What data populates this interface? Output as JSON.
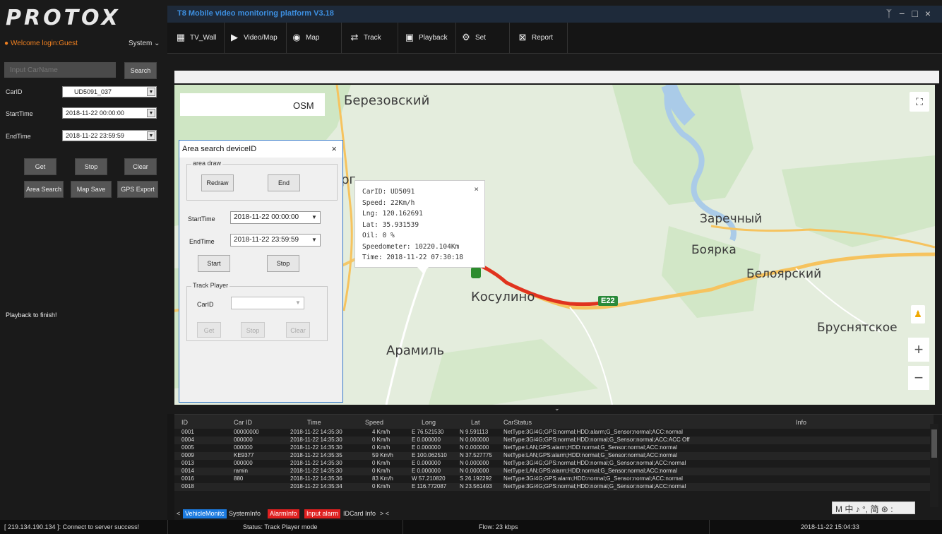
{
  "app": {
    "logo": "PROTOX",
    "title": "T8 Mobile video monitoring platform V3.18",
    "welcome": "Welcome login:Guest",
    "system_menu": "System"
  },
  "nav": [
    {
      "label": "TV_Wall",
      "icon": "grid-icon"
    },
    {
      "label": "Video/Map",
      "icon": "play-icon"
    },
    {
      "label": "Map",
      "icon": "map-pin-icon"
    },
    {
      "label": "Track",
      "icon": "track-icon"
    },
    {
      "label": "Playback",
      "icon": "camera-icon"
    },
    {
      "label": "Set",
      "icon": "gear-icon"
    },
    {
      "label": "Report",
      "icon": "report-icon"
    }
  ],
  "left": {
    "car_name_placeholder": "Input CarName",
    "search": "Search",
    "carid_label": "CarID",
    "carid_value": "UD5091_037",
    "starttime_label": "StartTime",
    "starttime_value": "2018-11-22 00:00:00",
    "endtime_label": "EndTime",
    "endtime_value": "2018-11-22 23:59:59",
    "get": "Get",
    "stop": "Stop",
    "clear": "Clear",
    "area_search": "Area Search",
    "map_save": "Map Save",
    "gps_export": "GPS Export",
    "playback_msg": "Playback to finish!"
  },
  "map": {
    "layer": "OSM",
    "towns": [
      "Березовский",
      "Заречный",
      "Боярка",
      "Белоярский",
      "Косулино",
      "Бруснятское",
      "Арамиль",
      "рг"
    ],
    "road": "E22",
    "popup": {
      "carid": "CarID:  UD5091",
      "speed": "Speed: 22Km/h",
      "lng": "Lng: 120.162691",
      "lat": "Lat: 35.931539",
      "oil": "Oil: 0 %",
      "speedometer": "Speedometer: 10220.104Km",
      "time": "Time: 2018-11-22 07:30:18"
    }
  },
  "dialog": {
    "title": "Area search deviceID",
    "area_draw": "area draw",
    "redraw": "Redraw",
    "end": "End",
    "starttime_label": "StartTime",
    "starttime_value": "2018-11-22 00:00:00",
    "endtime_label": "EndTime",
    "endtime_value": "2018-11-22 23:59:59",
    "start": "Start",
    "stop": "Stop",
    "track_player": "Track Player",
    "carid_label": "CarID",
    "get": "Get",
    "stop2": "Stop",
    "clear": "Clear"
  },
  "table": {
    "headers": [
      "ID",
      "Car ID",
      "Time",
      "Speed",
      "Long",
      "Lat",
      "CarStatus",
      "Info"
    ],
    "rows": [
      [
        "0001",
        "00000000",
        "2018-11-22 14:35:30",
        "4 Km/h",
        "E 76.521530",
        "N 9.591113",
        "NetType:3G/4G;GPS:normal;HDD:alarm;G_Sensor:normal;ACC:normal"
      ],
      [
        "0004",
        "000000",
        "2018-11-22 14:35:30",
        "0 Km/h",
        "E 0.000000",
        "N 0.000000",
        "NetType:3G/4G;GPS:normal;HDD:normal;G_Sensor:normal;ACC:ACC Off"
      ],
      [
        "0005",
        "000000",
        "2018-11-22 14:35:30",
        "0 Km/h",
        "E 0.000000",
        "N 0.000000",
        "NetType:LAN;GPS:alarm;HDD:normal;G_Sensor:normal;ACC:normal"
      ],
      [
        "0009",
        "KE9377",
        "2018-11-22 14:35:35",
        "59 Km/h",
        "E 100.062510",
        "N 37.527775",
        "NetType:LAN;GPS:alarm;HDD:normal;G_Sensor:normal;ACC:normal"
      ],
      [
        "0013",
        "000000",
        "2018-11-22 14:35:30",
        "0 Km/h",
        "E 0.000000",
        "N 0.000000",
        "NetType:3G/4G;GPS:normal;HDD:normal;G_Sensor:normal;ACC:normal"
      ],
      [
        "0014",
        "ramin",
        "2018-11-22 14:35:30",
        "0 Km/h",
        "E 0.000000",
        "N 0.000000",
        "NetType:LAN;GPS:alarm;HDD:normal;G_Sensor:normal;ACC:normal"
      ],
      [
        "0016",
        "880",
        "2018-11-22 14:35:36",
        "83 Km/h",
        "W 57.210820",
        "S 26.192292",
        "NetType:3G/4G;GPS:alarm;HDD:normal;G_Sensor:normal;ACC:normal"
      ],
      [
        "0018",
        "",
        "2018-11-22 14:35:34",
        "0 Km/h",
        "E 116.772087",
        "N 23.561493",
        "NetType:3G/4G;GPS:normal;HDD:normal;G_Sensor:normal;ACC:normal"
      ]
    ]
  },
  "tabs": [
    "VehicleMonitc",
    "SystemInfo",
    "AlarmInfo",
    "Input alarm",
    "IDCard Info"
  ],
  "ime": "M 中 ♪ °, 简 ⊛ :",
  "status": {
    "server": "[ 219.134.190.134 ]: Connect to server success!",
    "mode": "Status: Track Player mode",
    "flow": "Flow: 23 kbps",
    "time": "2018-11-22 15:04:33"
  }
}
